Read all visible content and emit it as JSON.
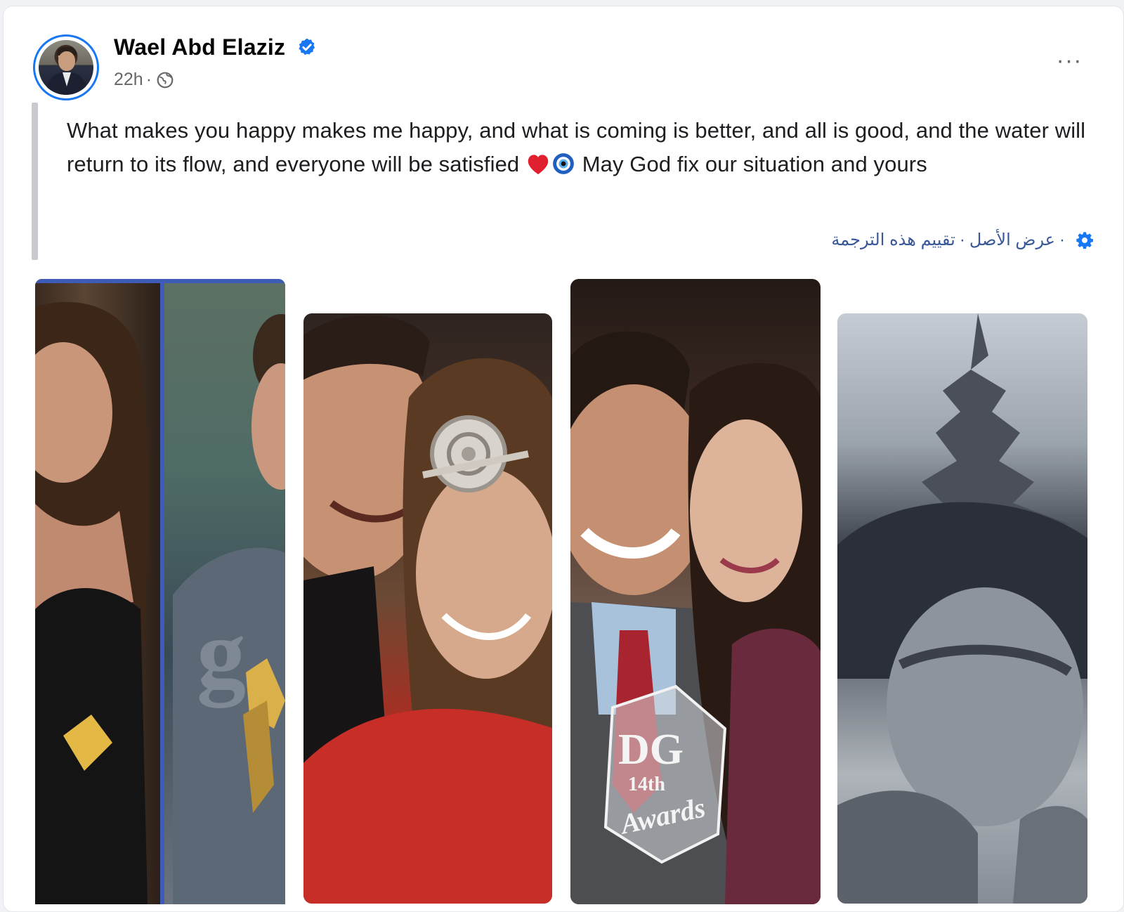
{
  "post": {
    "author": "Wael Abd Elaziz",
    "time": "22h",
    "meta_separator": "·",
    "more_label": "···",
    "text_part1": "What makes you happy makes me happy, and what is coming is better, and all is good, and the water will return to its flow, and everyone will be satisfied ",
    "text_part2": " May God fix our situation and yours",
    "emojis": [
      "heart-icon",
      "nazar-eye-icon"
    ]
  },
  "translation": {
    "see_original": "عرض الأصل",
    "rate_translation": "تقييم هذه الترجمة",
    "separator": "·"
  },
  "photos": [
    {
      "name": "photo-1"
    },
    {
      "name": "photo-2"
    },
    {
      "name": "photo-3"
    },
    {
      "name": "photo-4"
    }
  ],
  "photo_marks": {
    "watermark": "g",
    "award_text_1": "DG",
    "award_text_2": "14th",
    "award_text_3": "Awards"
  },
  "colors": {
    "verified": "#1877f2",
    "link": "#385898",
    "text": "#1c1e21",
    "meta": "#65676b"
  }
}
